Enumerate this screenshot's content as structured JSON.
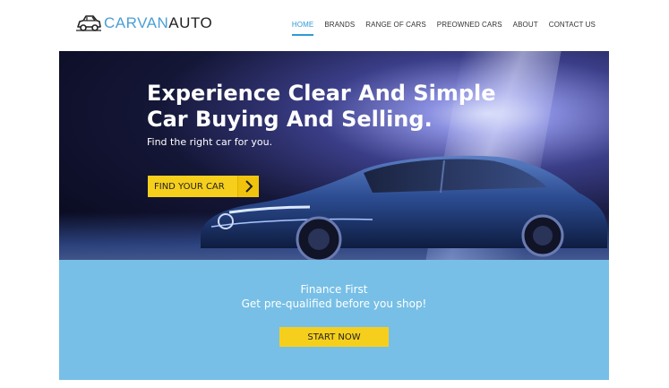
{
  "header": {
    "logo": {
      "part1": "CARVAN",
      "part2": "AUTO",
      "icon": "car-icon"
    },
    "nav": [
      {
        "label": "HOME",
        "active": true
      },
      {
        "label": "BRANDS",
        "active": false
      },
      {
        "label": "RANGE OF CARS",
        "active": false
      },
      {
        "label": "PREOWNED CARS",
        "active": false
      },
      {
        "label": "ABOUT",
        "active": false
      },
      {
        "label": "CONTACT US",
        "active": false
      }
    ]
  },
  "hero": {
    "title_line1": "Experience Clear And Simple",
    "title_line2": "Car Buying And Selling.",
    "subtitle": "Find the right car for you.",
    "cta_label": "FIND YOUR CAR",
    "cta_icon": "chevron-right-icon"
  },
  "finance": {
    "title": "Finance First",
    "subtitle": "Get pre-qualified before you shop!",
    "cta_label": "START NOW"
  },
  "colors": {
    "accent_blue": "#2e9ad6",
    "logo_blue": "#4a9fd6",
    "button_yellow": "#f6cf1c",
    "finance_band": "#77bfe6"
  }
}
